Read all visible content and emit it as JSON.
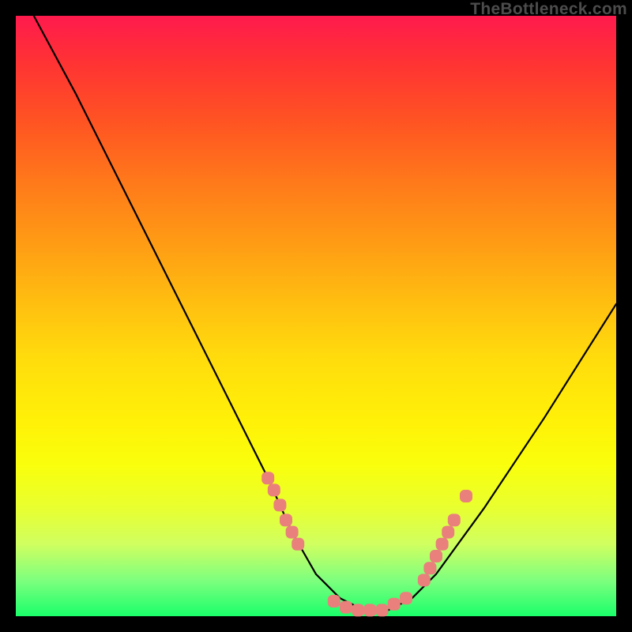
{
  "watermark": "TheBottleneck.com",
  "chart_data": {
    "type": "line",
    "title": "",
    "xlabel": "",
    "ylabel": "",
    "xlim": [
      0,
      100
    ],
    "ylim": [
      0,
      100
    ],
    "series": [
      {
        "name": "curve",
        "x": [
          3,
          10,
          20,
          30,
          37,
          42,
          46,
          50,
          54,
          58,
          62,
          66,
          70,
          78,
          88,
          100
        ],
        "y": [
          100,
          87,
          67,
          47,
          33,
          23,
          14,
          7,
          3,
          1,
          1,
          3,
          7,
          18,
          33,
          52
        ]
      }
    ],
    "markers": [
      {
        "name": "left-cluster",
        "points": [
          [
            42,
            23
          ],
          [
            43,
            21
          ],
          [
            44,
            18.5
          ],
          [
            45,
            16
          ],
          [
            46,
            14
          ],
          [
            47,
            12
          ]
        ]
      },
      {
        "name": "bottom-cluster",
        "points": [
          [
            53,
            2.5
          ],
          [
            55,
            1.5
          ],
          [
            57,
            1
          ],
          [
            59,
            1
          ],
          [
            61,
            1
          ],
          [
            63,
            2
          ],
          [
            65,
            3
          ]
        ]
      },
      {
        "name": "right-cluster",
        "points": [
          [
            68,
            6
          ],
          [
            69,
            8
          ],
          [
            70,
            10
          ],
          [
            71,
            12
          ],
          [
            72,
            14
          ],
          [
            73,
            16
          ],
          [
            75,
            20
          ]
        ]
      }
    ],
    "marker_color": "#e9807c",
    "curve_color": "#000000"
  }
}
